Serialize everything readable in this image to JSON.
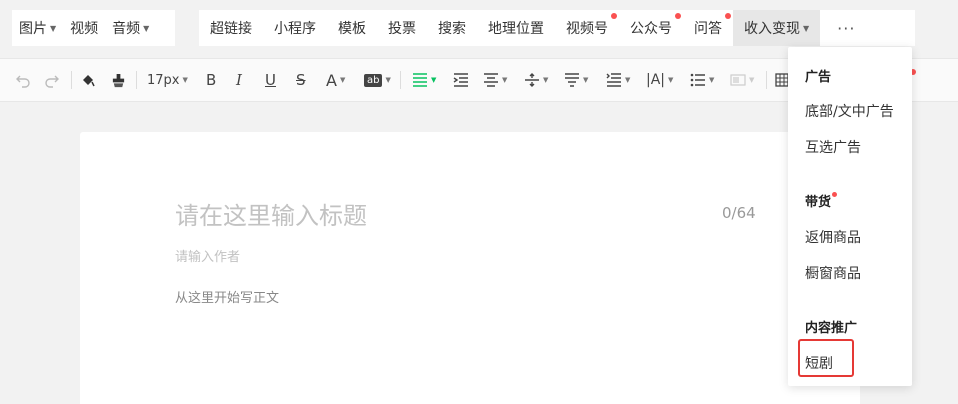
{
  "topbar": {
    "group1": [
      {
        "label": "图片",
        "dropdown": true
      },
      {
        "label": "视频",
        "dropdown": false
      },
      {
        "label": "音频",
        "dropdown": true
      }
    ],
    "group2": [
      {
        "label": "超链接",
        "dot": false
      },
      {
        "label": "小程序",
        "dot": false
      },
      {
        "label": "模板",
        "dot": false
      },
      {
        "label": "投票",
        "dot": false
      },
      {
        "label": "搜索",
        "dot": false
      },
      {
        "label": "地理位置",
        "dot": false
      },
      {
        "label": "视频号",
        "dot": true
      },
      {
        "label": "公众号",
        "dot": true
      },
      {
        "label": "问答",
        "dot": true
      },
      {
        "label": "收入变现",
        "dropdown": true,
        "active": true
      }
    ],
    "more_label": "···"
  },
  "fmtbar": {
    "font_size": "17px",
    "bold": "B",
    "italic": "I",
    "underline": "U",
    "strike": "S",
    "font_color": "A",
    "bg_color": "ab",
    "letter_spacing": "|A|",
    "icons": [
      "undo-icon",
      "redo-icon",
      "format-painter-icon",
      "clear-format-icon",
      "align-left-icon",
      "indent-icon",
      "align-center-icon",
      "line-height-icon",
      "paragraph-spacing-icon",
      "indent-first-icon",
      "list-icon",
      "disabled-block-icon",
      "table-icon"
    ]
  },
  "editor": {
    "title_placeholder": "请在这里输入标题",
    "title_counter": "0/64",
    "author_placeholder": "请输入作者",
    "body_placeholder": "从这里开始写正文"
  },
  "dropdown": {
    "sections": [
      {
        "heading": "广告",
        "dot": false,
        "items": [
          "底部/文中广告",
          "互选广告"
        ]
      },
      {
        "heading": "带货",
        "dot": true,
        "items": [
          "返佣商品",
          "橱窗商品"
        ]
      },
      {
        "heading": "内容推广",
        "dot": false,
        "items": [
          "短剧"
        ]
      }
    ]
  },
  "colors": {
    "accent_green": "#07c160",
    "badge_red": "#fa5151",
    "highlight_red": "#e53935"
  }
}
